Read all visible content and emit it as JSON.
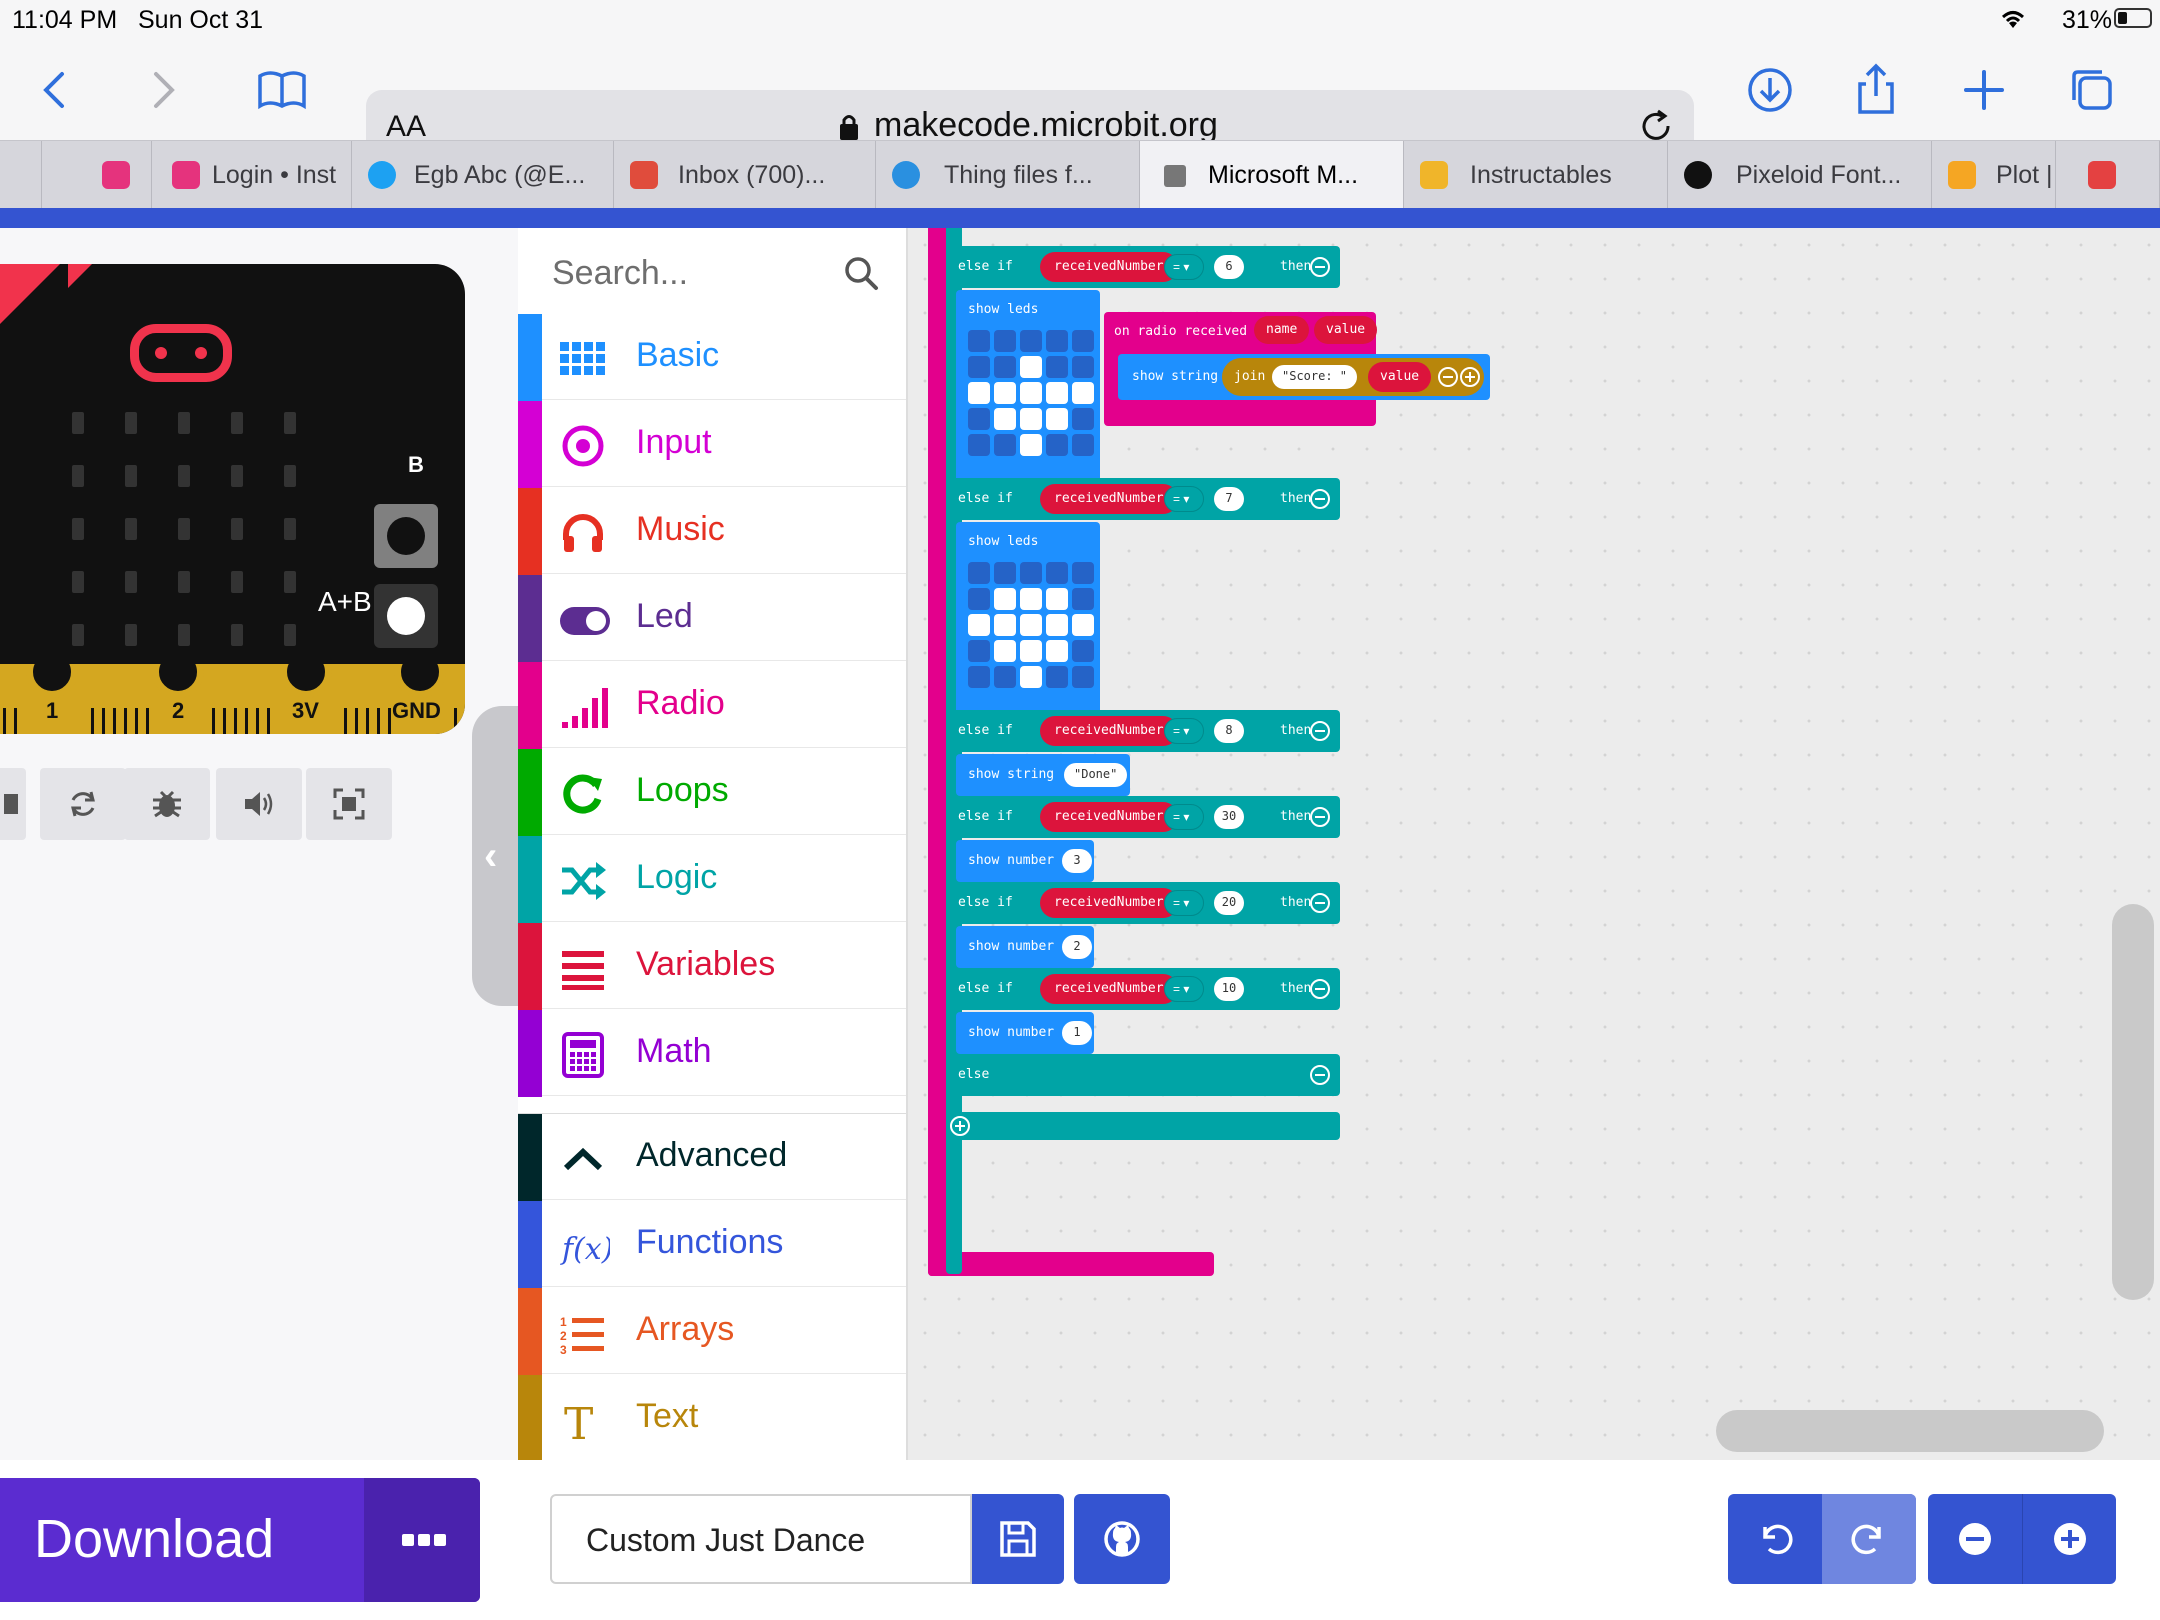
{
  "status": {
    "time": "11:04 PM",
    "date": "Sun Oct 31",
    "battery": "31%",
    "battery_level": 0.31
  },
  "browser": {
    "aa": "AA",
    "host": "makecode.microbit.org",
    "tabs": [
      {
        "label": "",
        "color": "#e5337d"
      },
      {
        "label": "Login • Inst",
        "color": "#e5337d"
      },
      {
        "label": "Egb Abc (@E...",
        "color": "#1da1f2"
      },
      {
        "label": "Inbox (700)...",
        "color": "#e04c3c"
      },
      {
        "label": "Thing files f...",
        "color": "#2a90e0"
      },
      {
        "label": "Microsoft M...",
        "color": "#777777"
      },
      {
        "label": "Instructables",
        "color": "#f0b52a"
      },
      {
        "label": "Pixeloid Font...",
        "color": "#111111"
      },
      {
        "label": "Plot |",
        "color": "#f5a623"
      },
      {
        "label": "",
        "color": "#e44141"
      }
    ]
  },
  "simulator": {
    "label_ab": "A+B",
    "label_b": "B",
    "pins": [
      "1",
      "2",
      "3V",
      "GND"
    ]
  },
  "toolbox": {
    "search_placeholder": "Search...",
    "categories": [
      {
        "label": "Basic",
        "color": "#1e90ff",
        "icon": "grid-icon"
      },
      {
        "label": "Input",
        "color": "#d400d4",
        "icon": "target-icon"
      },
      {
        "label": "Music",
        "color": "#e63022",
        "icon": "headphones-icon"
      },
      {
        "label": "Led",
        "color": "#5c2d91",
        "icon": "toggle-icon"
      },
      {
        "label": "Radio",
        "color": "#e3008c",
        "icon": "signal-icon"
      },
      {
        "label": "Loops",
        "color": "#00aa00",
        "icon": "loop-icon"
      },
      {
        "label": "Logic",
        "color": "#00a4a6",
        "icon": "shuffle-icon"
      },
      {
        "label": "Variables",
        "color": "#dc143c",
        "icon": "lines-icon"
      },
      {
        "label": "Math",
        "color": "#9400d3",
        "icon": "calculator-icon"
      },
      {
        "label": "Advanced",
        "color": "#00272b",
        "icon": "chevron-up-icon"
      },
      {
        "label": "Functions",
        "color": "#3455db",
        "icon": "function-icon"
      },
      {
        "label": "Arrays",
        "color": "#e65722",
        "icon": "list-icon"
      },
      {
        "label": "Text",
        "color": "#b8860b",
        "icon": "text-icon"
      }
    ]
  },
  "code": {
    "else_if": "else if",
    "then": "then",
    "var": "receivedNumber",
    "eq": "= ▾",
    "show_leds": "show leds",
    "show_string": "show string",
    "show_number": "show number",
    "else": "else",
    "n6": "6",
    "n7": "7",
    "n8": "8",
    "n30": "30",
    "n20": "20",
    "n10": "10",
    "num3": "3",
    "num2": "2",
    "num1": "1",
    "done": "\"Done\"",
    "radio_received": "on radio received",
    "name": "name",
    "value": "value",
    "join": "join",
    "score": "\"Score: \"",
    "value2": "value"
  },
  "bottom": {
    "download": "Download",
    "project_name": "Custom Just Dance"
  }
}
